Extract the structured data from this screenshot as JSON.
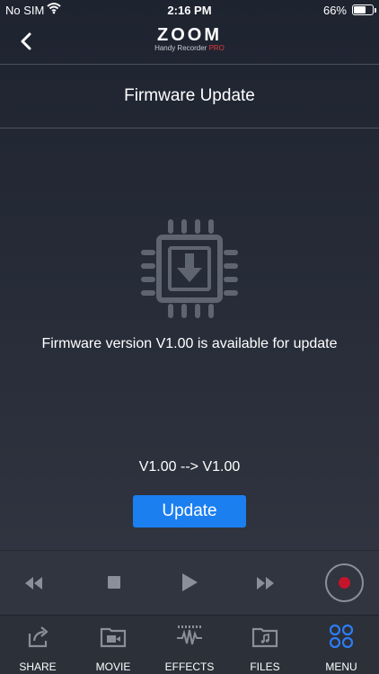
{
  "status": {
    "carrier": "No SIM",
    "time": "2:16 PM",
    "battery_pct": "66%",
    "battery_level": 0.66
  },
  "header": {
    "brand": "ZOOM",
    "subtitle": "Handy Recorder",
    "subtitle_pro": "PRO"
  },
  "page": {
    "title": "Firmware Update",
    "message": "Firmware version V1.00 is available for update",
    "version_compare": "V1.00 --> V1.00",
    "update_label": "Update"
  },
  "tabs": [
    {
      "label": "SHARE",
      "icon": "share-icon"
    },
    {
      "label": "MOVIE",
      "icon": "movie-folder-icon"
    },
    {
      "label": "EFFECTS",
      "icon": "effects-icon"
    },
    {
      "label": "FILES",
      "icon": "files-folder-icon"
    },
    {
      "label": "MENU",
      "icon": "menu-grid-icon",
      "active": true
    }
  ],
  "colors": {
    "accent": "#1c7ff0",
    "record": "#c4152a",
    "active_tab": "#2e7cf6",
    "icon_gray": "#8a8f99"
  }
}
